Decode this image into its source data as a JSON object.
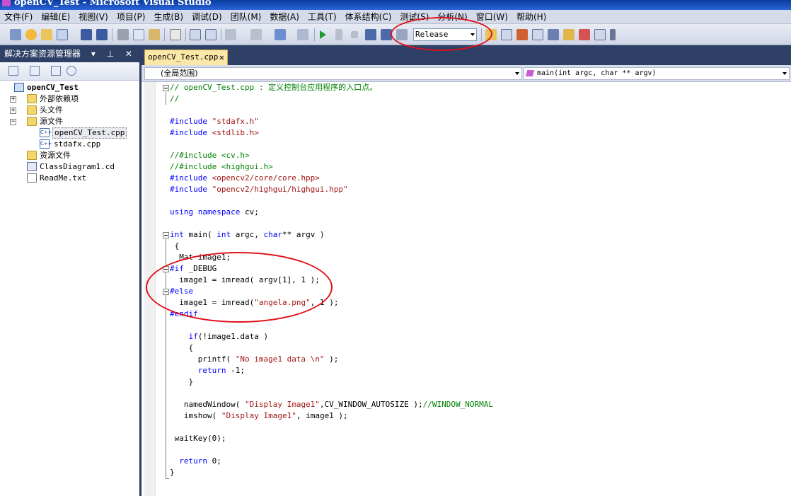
{
  "window": {
    "title": "openCV_Test - Microsoft Visual Studio"
  },
  "menu": [
    "文件(F)",
    "编辑(E)",
    "视图(V)",
    "项目(P)",
    "生成(B)",
    "调试(D)",
    "团队(M)",
    "数据(A)",
    "工具(T)",
    "体系结构(C)",
    "测试(S)",
    "分析(N)",
    "窗口(W)",
    "帮助(H)"
  ],
  "toolbar": {
    "config_value": "Release"
  },
  "solution_explorer": {
    "title": "解决方案资源管理器",
    "controls": "▾ ⊥ ✕",
    "tree": [
      {
        "label": "openCV_Test",
        "icon": "project-icon"
      },
      {
        "label": "外部依赖项",
        "icon": "folder-icon"
      },
      {
        "label": "头文件",
        "icon": "folder-icon"
      },
      {
        "label": "源文件",
        "icon": "folder-open-icon"
      },
      {
        "label": "openCV_Test.cpp",
        "icon": "cpp-file-icon"
      },
      {
        "label": "stdafx.cpp",
        "icon": "cpp-file-icon"
      },
      {
        "label": "资源文件",
        "icon": "folder-icon"
      },
      {
        "label": "ClassDiagram1.cd",
        "icon": "class-diagram-icon"
      },
      {
        "label": "ReadMe.txt",
        "icon": "text-file-icon"
      }
    ]
  },
  "editor": {
    "tab_label": "openCV_Test.cpp",
    "tab_close": "✕",
    "scope_dropdown": "(全局范围)",
    "member_dropdown": "main(int argc, char ** argv)",
    "code_lines": [
      "// openCV_Test.cpp : 定义控制台应用程序的入口点。",
      "//",
      "",
      "#include \"stdafx.h\"",
      "#include <stdlib.h>",
      "",
      "//#include <cv.h>",
      "//#include <highgui.h>",
      "#include <opencv2/core/core.hpp>",
      "#include \"opencv2/highgui/highgui.hpp\"",
      "",
      "using namespace cv;",
      "",
      "int main( int argc, char** argv )",
      " {",
      "  Mat image1;",
      "#if _DEBUG",
      "  image1 = imread( argv[1], 1 );",
      "#else",
      "  image1 = imread(\"angela.png\", 1 );",
      "#endif",
      "",
      "    if(!image1.data )",
      "    {",
      "      printf( \"No image1 data \\n\" );",
      "      return -1;",
      "    }",
      "",
      "   namedWindow( \"Display Image1\",CV_WINDOW_AUTOSIZE );//WINDOW_NORMAL",
      "   imshow( \"Display Image1\", image1 );",
      "",
      " waitKey(0);",
      "",
      "  return 0;",
      "}"
    ]
  },
  "colors": {
    "keyword": "#0000ff",
    "string": "#a31515",
    "comment": "#008000",
    "annotation": "#e0101a",
    "panel_header": "#2e4066"
  }
}
